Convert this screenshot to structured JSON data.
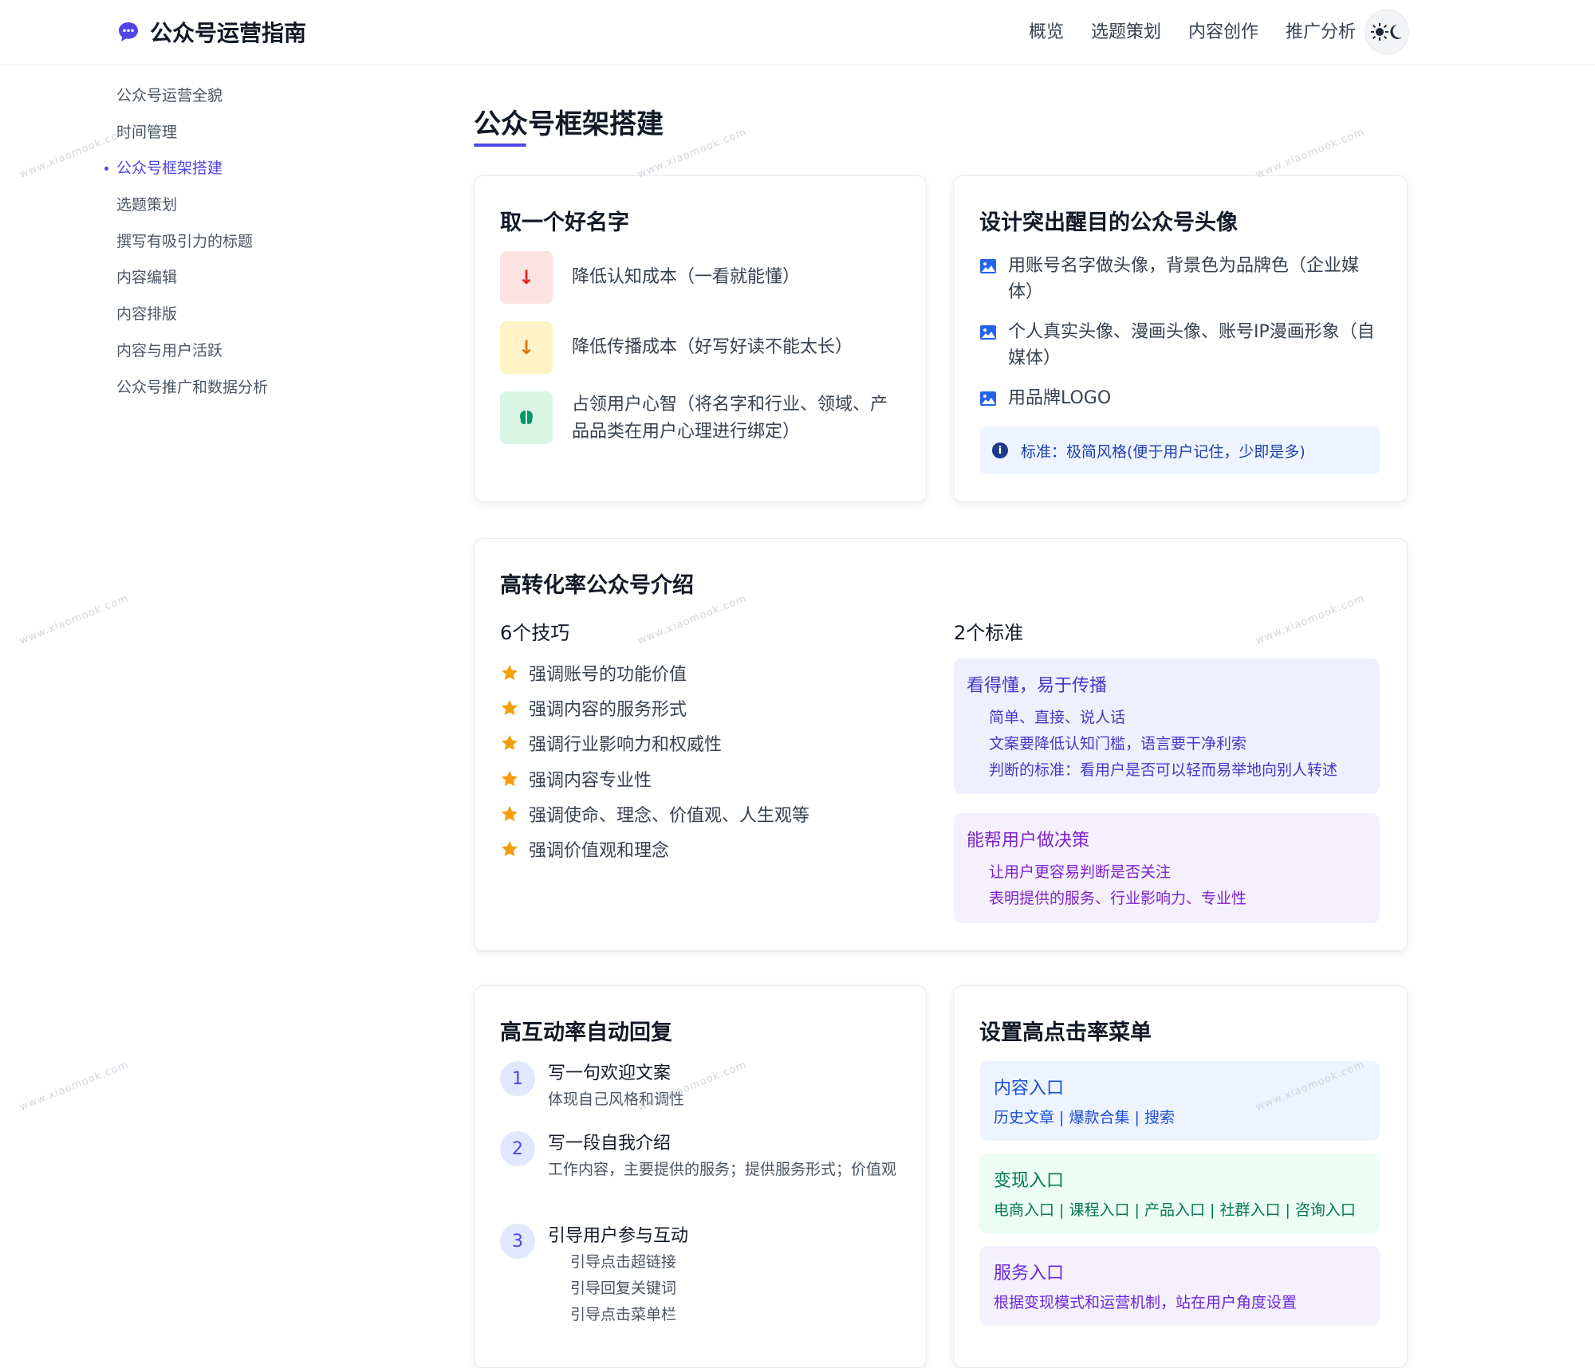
{
  "header": {
    "logo_text": "公众号运营指南",
    "nav": [
      "概览",
      "选题策划",
      "内容创作",
      "推广分析"
    ]
  },
  "sidebar": {
    "items": [
      {
        "label": "公众号运营全貌"
      },
      {
        "label": "时间管理"
      },
      {
        "label": "公众号框架搭建"
      },
      {
        "label": "选题策划"
      },
      {
        "label": "撰写有吸引力的标题"
      },
      {
        "label": "内容编辑"
      },
      {
        "label": "内容排版"
      },
      {
        "label": "内容与用户活跃"
      },
      {
        "label": "公众号推广和数据分析"
      }
    ],
    "active_index": 2
  },
  "page": {
    "title": "公众号框架搭建"
  },
  "name_card": {
    "title": "取一个好名字",
    "items": [
      {
        "icon": "arrow-down-icon",
        "glyph": "↓",
        "text": "降低认知成本（一看就能懂）",
        "color": "#dc2626",
        "bg": "#fde2e2"
      },
      {
        "icon": "arrow-down-icon",
        "glyph": "↓",
        "text": "降低传播成本（好写好读不能太长）",
        "color": "#d97706",
        "bg": "#fdf3c7"
      },
      {
        "icon": "brain-icon",
        "glyph": "",
        "text": "占领用户心智（将名字和行业、领域、产品品类在用户心理进行绑定）",
        "color": "#059669",
        "bg": "#d8f5e6"
      }
    ]
  },
  "avatar_card": {
    "title": "设计突出醒目的公众号头像",
    "items": [
      {
        "text": "用账号名字做头像，背景色为品牌色（企业媒体）"
      },
      {
        "text": "个人真实头像、漫画头像、账号IP漫画形象（自媒体）"
      },
      {
        "text": "用品牌LOGO"
      }
    ],
    "note": "标准：极简风格(便于用户记住，少即是多)"
  },
  "intro_card": {
    "title": "高转化率公众号介绍",
    "tips_heading": "6个技巧",
    "tips": [
      {
        "text": "强调账号的功能价值"
      },
      {
        "text": "强调内容的服务形式"
      },
      {
        "text": "强调行业影响力和权威性"
      },
      {
        "text": "强调内容专业性"
      },
      {
        "text": "强调使命、理念、价值观、人生观等"
      },
      {
        "text": "强调价值观和理念"
      }
    ],
    "standards_heading": "2个标准",
    "standards": [
      {
        "title": "看得懂，易于传播",
        "lines": [
          "简单、直接、说人话",
          "文案要降低认知门槛，语言要干净利索",
          "判断的标准：看用户是否可以轻而易举地向别人转述"
        ],
        "color": "#4338ca",
        "bg": "#eef1fd"
      },
      {
        "title": "能帮用户做决策",
        "lines": [
          "让用户更容易判断是否关注",
          "表明提供的服务、行业影响力、专业性"
        ],
        "color": "#7e22ce",
        "bg": "#f5f0fd"
      }
    ]
  },
  "reply_card": {
    "title": "高互动率自动回复",
    "steps": [
      {
        "num": "1",
        "title": "写一句欢迎文案",
        "desc": "体现自己风格和调性",
        "subs": []
      },
      {
        "num": "2",
        "title": "写一段自我介绍",
        "desc": "工作内容，主要提供的服务；提供服务形式；价值观",
        "subs": []
      },
      {
        "num": "3",
        "title": "引导用户参与互动",
        "desc": "",
        "subs": [
          "引导点击超链接",
          "引导回复关键词",
          "引导点击菜单栏"
        ]
      }
    ]
  },
  "menu_card": {
    "title": "设置高点击率菜单",
    "entries": [
      {
        "title": "内容入口",
        "desc": "历史文章 | 爆款合集 | 搜索",
        "color": "#1d4ed8",
        "bg": "#eef4ff"
      },
      {
        "title": "变现入口",
        "desc": "电商入口 | 课程入口 | 产品入口 | 社群入口 | 咨询入口",
        "color": "#047857",
        "bg": "#ecfdf3"
      },
      {
        "title": "服务入口",
        "desc": "根据变现模式和运营机制，站在用户角度设置",
        "color": "#6d28d9",
        "bg": "#f4f0fe"
      }
    ]
  },
  "watermark": "www.xiaomook.com",
  "colors": {
    "accent": "#4f46e5",
    "star": "#f59e0b"
  }
}
